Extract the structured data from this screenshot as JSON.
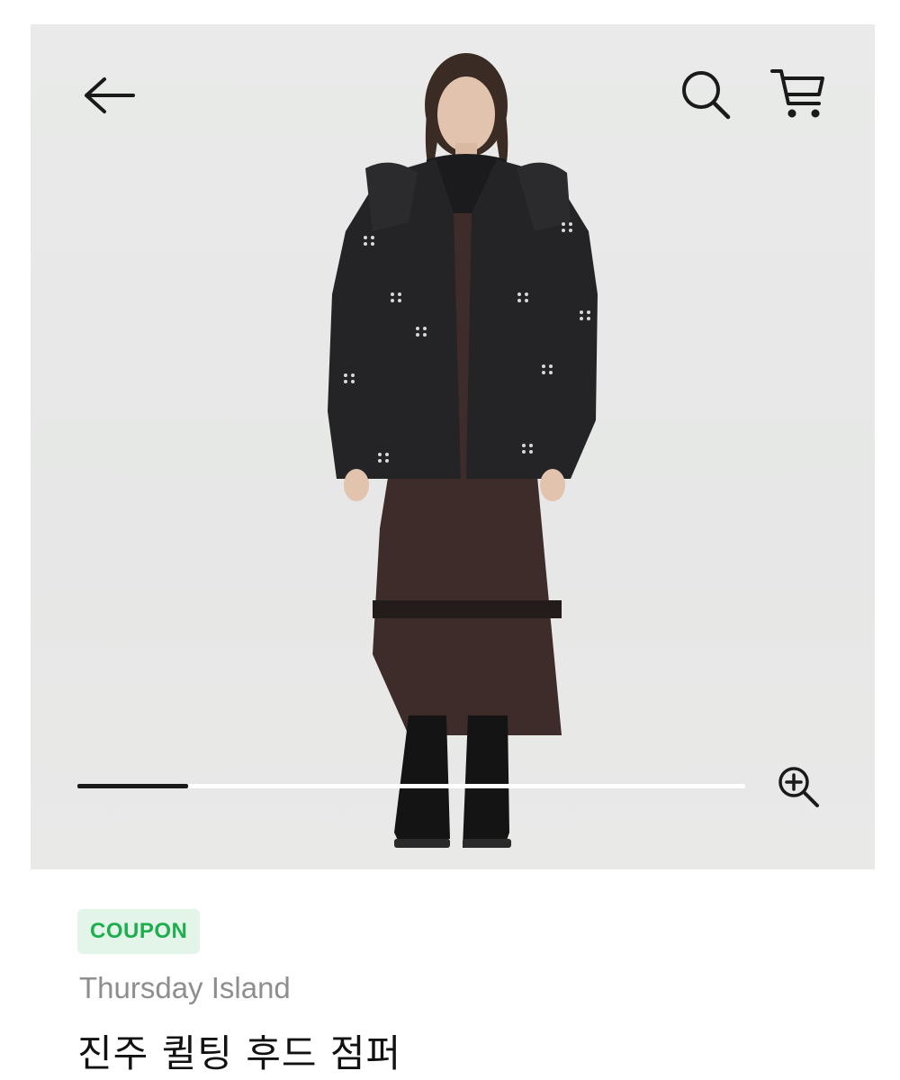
{
  "header": {
    "back_icon": "arrow-left-icon",
    "search_icon": "search-icon",
    "cart_icon": "cart-icon"
  },
  "gallery": {
    "progress_fraction": 0.166,
    "zoom_icon": "zoom-in-icon"
  },
  "product": {
    "badge": "COUPON",
    "brand": "Thursday Island",
    "name": "진주 퀼팅 후드 점퍼"
  },
  "colors": {
    "badge_bg": "#e3f5e8",
    "badge_text": "#1fae4f",
    "brand_text": "#8e8e8e",
    "name_text": "#111111"
  }
}
